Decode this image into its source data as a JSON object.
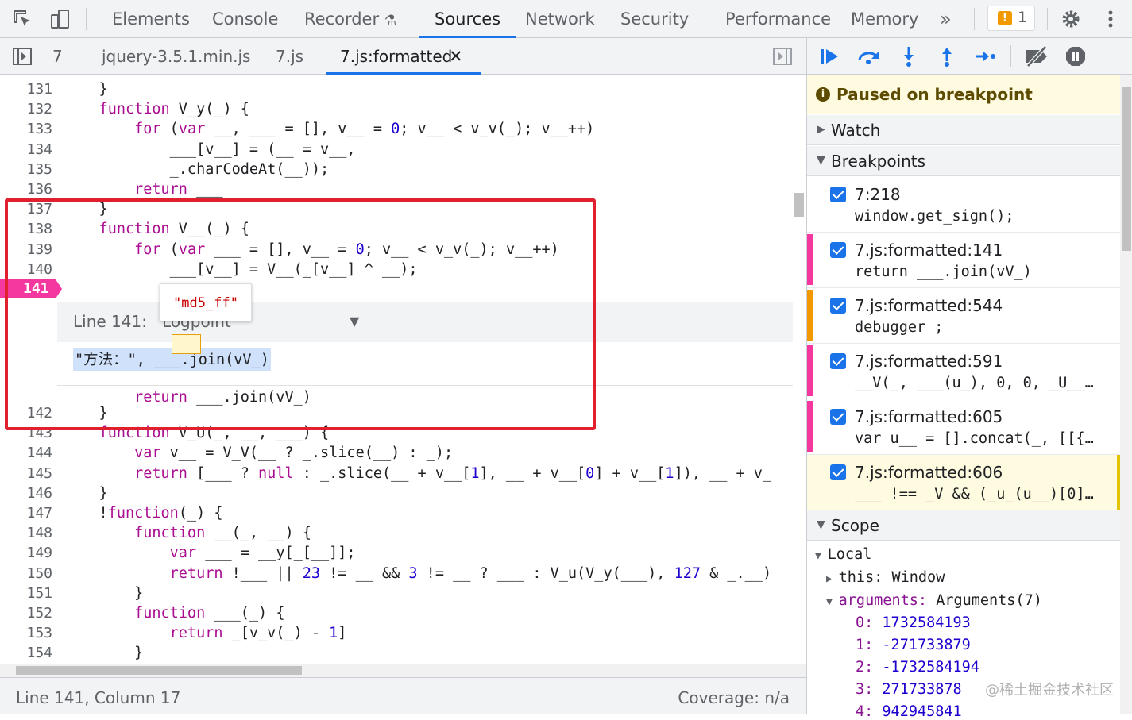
{
  "panel_tabs": [
    "Elements",
    "Console",
    "Recorder",
    "Sources",
    "Network",
    "Security",
    "Performance",
    "Memory"
  ],
  "issues_count": "1",
  "file_tabs": [
    "7",
    "jquery-3.5.1.min.js",
    "7.js",
    "7.js:formatted"
  ],
  "editor": {
    "lines": [
      {
        "n": "131",
        "code": "    }"
      },
      {
        "n": "132",
        "code": "    function V_y(_) {"
      },
      {
        "n": "133",
        "code": "        for (var __, ___ = [], v__ = 0; v__ < v_v(_); v__++)"
      },
      {
        "n": "134",
        "code": "            ___[v__] = (__ = v__,"
      },
      {
        "n": "135",
        "code": "            _.charCodeAt(__));"
      },
      {
        "n": "136",
        "code": "        return ___"
      },
      {
        "n": "137",
        "code": "    }"
      },
      {
        "n": "138",
        "code": "    function V__(_) {"
      },
      {
        "n": "139",
        "code": "        for (var ___ = [], v__ = 0; v__ < v_v(_); v__++)"
      },
      {
        "n": "140",
        "code": "            ___[v__] = V__(_[v__] ^ __);"
      }
    ],
    "breakpoint_line": "141",
    "logpoint_title": "Line 141:   Logpoint",
    "logpoint_expr": "\"方法：\", ___.join(vV_)",
    "line_141_code": "        return ___.join(vV_)",
    "lines_after": [
      {
        "n": "142",
        "code": "    }"
      },
      {
        "n": "143",
        "code": "    function V_U(_, __, ___) {"
      },
      {
        "n": "144",
        "code": "        var v__ = V_V(__ ? _.slice(__) : _);"
      },
      {
        "n": "145",
        "code": "        return [___ ? null : _.slice(__ + v__[1], __ + v__[0] + v__[1]), __ + v_"
      },
      {
        "n": "146",
        "code": "    }"
      },
      {
        "n": "147",
        "code": "    !function(_) {"
      },
      {
        "n": "148",
        "code": "        function __(_, __) {"
      },
      {
        "n": "149",
        "code": "            var ___ = __y[_[__]];"
      },
      {
        "n": "150",
        "code": "            return !___ || 23 != __ && 3 != __ ? ___ : V_u(V_y(___), 127 & _.__)"
      },
      {
        "n": "151",
        "code": "        }"
      },
      {
        "n": "152",
        "code": "        function ___(_) {"
      },
      {
        "n": "153",
        "code": "            return _[v_v(_) - 1]"
      },
      {
        "n": "154",
        "code": "        }"
      }
    ],
    "tooltip": "\"md5_ff\""
  },
  "status": {
    "position": "Line 141, Column 17",
    "coverage": "Coverage: n/a"
  },
  "right": {
    "paused": "Paused on breakpoint",
    "watch": "Watch",
    "breakpoints_label": "Breakpoints",
    "breakpoints": [
      {
        "loc": "7:218",
        "src": "window.get_sign();",
        "color": "#ffffff"
      },
      {
        "loc": "7.js:formatted:141",
        "src": "return ___.join(vV_)",
        "color": "#f538a0"
      },
      {
        "loc": "7.js:formatted:544",
        "src": "debugger ;",
        "color": "#f29900"
      },
      {
        "loc": "7.js:formatted:591",
        "src": "__V(_, ___(u_), 0, 0, _U__…",
        "color": "#f538a0"
      },
      {
        "loc": "7.js:formatted:605",
        "src": "var u__ = [].concat(_, [[{…",
        "color": "#f538a0"
      },
      {
        "loc": "7.js:formatted:606",
        "src": "___ !== _V && (_u_(u__)[0]…",
        "color": "#fffbe0"
      }
    ],
    "scope": "Scope",
    "local": "Local",
    "this_key": "this:",
    "this_val": "Window",
    "args_key": "arguments:",
    "args_val": "Arguments(7)",
    "args": [
      {
        "k": "0:",
        "v": "1732584193"
      },
      {
        "k": "1:",
        "v": "-271733879"
      },
      {
        "k": "2:",
        "v": "-1732584194"
      },
      {
        "k": "3:",
        "v": "271733878"
      },
      {
        "k": "4:",
        "v": "942945841"
      }
    ]
  },
  "watermark": "@稀土掘金技术社区"
}
